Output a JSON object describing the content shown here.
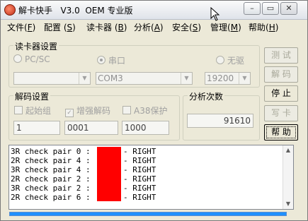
{
  "window": {
    "title": "解卡快手   V3.0  OEM 专业版",
    "caption_buttons": [
      "minimize-icon",
      "maximize-icon",
      "close-icon"
    ]
  },
  "menu": [
    {
      "label": "文件",
      "key": "F"
    },
    {
      "label": "配置",
      "key": "S"
    },
    {
      "label": "读卡器",
      "key": "B"
    },
    {
      "label": "分析",
      "key": "A"
    },
    {
      "label": "安全",
      "key": "S"
    },
    {
      "label": "管理",
      "key": "M"
    },
    {
      "label": "帮助",
      "key": "H"
    }
  ],
  "reader": {
    "title": "读卡器设置",
    "options": [
      "PC/SC",
      "串口",
      "无驱"
    ],
    "selected": "串口",
    "port_value": "COM3",
    "baud_value": "19200",
    "first_combo_value": ""
  },
  "decode": {
    "title": "解码设置",
    "checks": [
      {
        "label": "起始组",
        "checked": false
      },
      {
        "label": "增强解码",
        "checked": true
      },
      {
        "label": "A38保护",
        "checked": false
      }
    ],
    "values": [
      "1",
      "0001",
      "1000"
    ]
  },
  "analysis": {
    "title": "分析次数",
    "count": "91610"
  },
  "buttons": [
    {
      "label": "测 试",
      "enabled": false
    },
    {
      "label": "解 码",
      "enabled": false
    },
    {
      "label": "停 止",
      "enabled": true
    },
    {
      "label": "写 卡",
      "enabled": false
    },
    {
      "label": "帮 助",
      "enabled": true
    }
  ],
  "log": [
    {
      "prefix": "3R check pair 0 :",
      "result": "- RIGHT"
    },
    {
      "prefix": "2R check pair 4 :",
      "result": "- RIGHT"
    },
    {
      "prefix": "3R check pair 4 :",
      "result": "- RIGHT"
    },
    {
      "prefix": "2R check pair 2 :",
      "result": "- RIGHT"
    },
    {
      "prefix": "3R check pair 2 :",
      "result": "- RIGHT"
    },
    {
      "prefix": "2R check pair 6 :",
      "result": "- RIGHT"
    }
  ],
  "colors": {
    "highlight": "#ff0000",
    "progress": "#1e90ff"
  },
  "progress_fraction": 1.0
}
